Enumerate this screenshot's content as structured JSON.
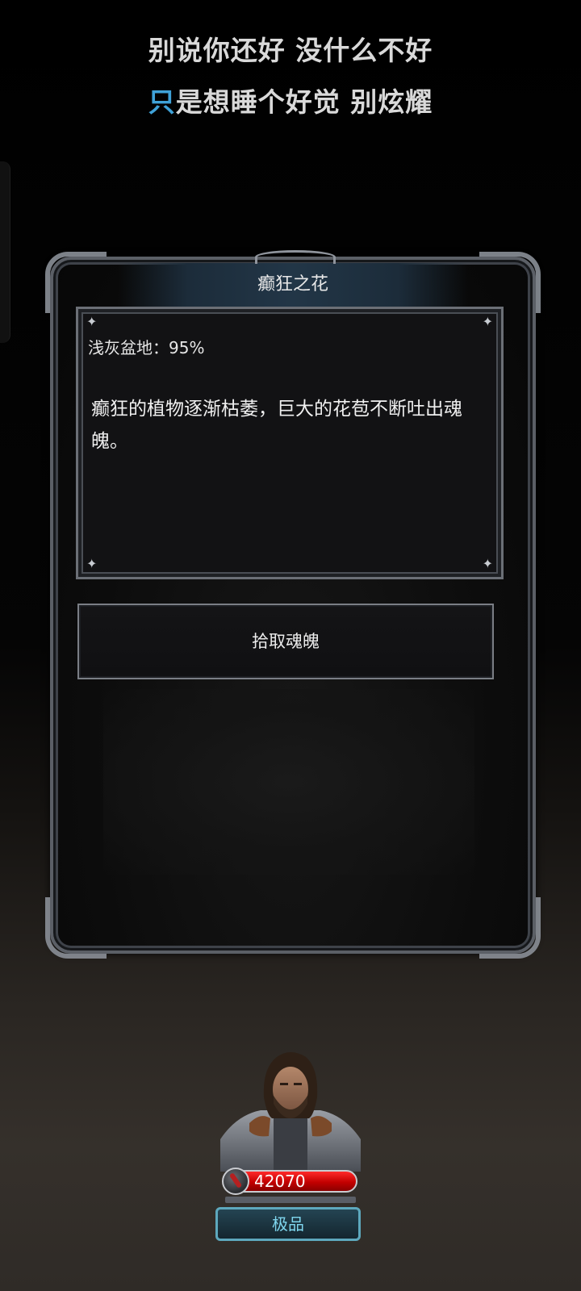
{
  "lyrics": {
    "line1": "别说你还好 没什么不好",
    "line2_highlight": "只",
    "line2_rest": "是想睡个好觉 别炫耀",
    "highlight_color": "#3fa2d8"
  },
  "event": {
    "title": "癫狂之花",
    "location": "浅灰盆地：95%",
    "description": "癫狂的植物逐渐枯萎，巨大的花苞不断吐出魂魄。",
    "action_label": "拾取魂魄"
  },
  "hero": {
    "power": "42070",
    "rank": "极品",
    "power_bar_color": "#d40000",
    "rank_color": "#7fd6ee"
  },
  "icons": {
    "power": "sword-medallion-icon",
    "corners": "sparkle-icon"
  }
}
